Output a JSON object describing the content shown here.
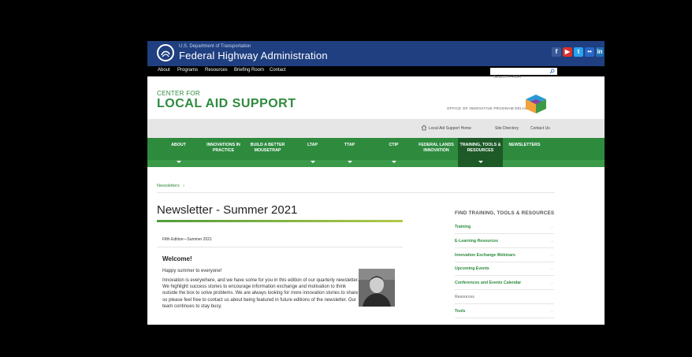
{
  "dot": {
    "department": "U.S. Department of Transportation",
    "agency": "Federal Highway Administration",
    "social": [
      {
        "icon": "facebook-icon",
        "glyph": "f",
        "color": "#3b5998"
      },
      {
        "icon": "youtube-icon",
        "glyph": "▶",
        "color": "#d9322c"
      },
      {
        "icon": "twitter-icon",
        "glyph": "t",
        "color": "#2aa3ef"
      },
      {
        "icon": "flickr-icon",
        "glyph": "••",
        "color": "#2a67c9"
      },
      {
        "icon": "linkedin-icon",
        "glyph": "in",
        "color": "#1f6fb2"
      }
    ]
  },
  "top_nav": {
    "items": [
      "About",
      "Programs",
      "Resources",
      "Briefing Room",
      "Contact"
    ],
    "search_placeholder": "Search FHWA"
  },
  "header": {
    "small": "CENTER FOR",
    "big": "LOCAL AID SUPPORT",
    "office": "OFFICE OF INNOVATIVE PROGRAM DELIVERY"
  },
  "util": {
    "home": "Local Aid Support Home",
    "directory": "Site Directory",
    "contact": "Contact Us"
  },
  "main_nav": [
    {
      "label": "ABOUT",
      "chevron": true
    },
    {
      "label": "INNOVATIONS IN PRACTICE",
      "chevron": false
    },
    {
      "label": "BUILD A BETTER MOUSETRAP",
      "chevron": false
    },
    {
      "label": "LTAP",
      "chevron": true
    },
    {
      "label": "TTAP",
      "chevron": true
    },
    {
      "label": "CTIP",
      "chevron": true
    },
    {
      "label": "FEDERAL LANDS INNOVATION",
      "chevron": false
    },
    {
      "label": "TRAINING, TOOLS & RESOURCES",
      "chevron": true
    },
    {
      "label": "NEWSLETTERS",
      "chevron": false
    }
  ],
  "breadcrumb": "Newsletters",
  "article": {
    "title": "Newsletter - Summer 2021",
    "edition": "Fifth Edition—Summer 2021",
    "welcome": "Welcome!",
    "greeting": "Happy summer to everyone!",
    "body": "Innovation is everywhere, and we have some for you in this edition of our quarterly newsletter. We highlight success stories to encourage information exchange and motivation to think outside the box to solve problems. We are always looking for more innovation stories to share so please feel free to contact us about being featured in future editions of the newsletter. Our team continues to stay busy."
  },
  "sidebar": {
    "title": "FIND TRAINING, TOOLS & RESOURCES",
    "items": [
      {
        "label": "Training",
        "link": true
      },
      {
        "label": "E-Learning Resources",
        "link": true
      },
      {
        "label": "Innovation Exchange Webinars",
        "link": true
      },
      {
        "label": "Upcoming Events",
        "link": true
      },
      {
        "label": "Conferences and Events Calendar",
        "link": true
      },
      {
        "label": "Resources",
        "link": false
      },
      {
        "label": "Tools",
        "link": true
      }
    ]
  }
}
